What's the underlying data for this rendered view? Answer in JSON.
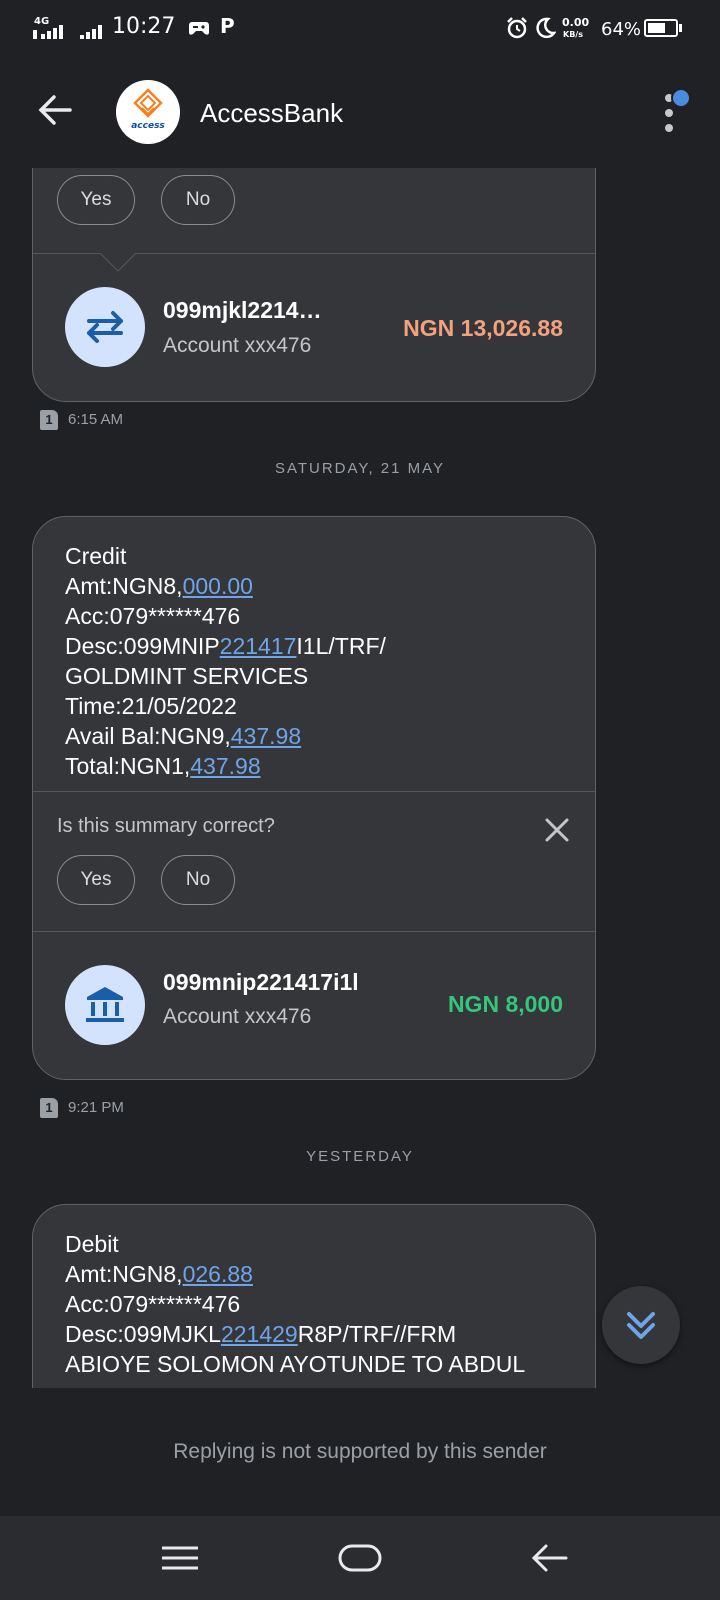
{
  "status_bar": {
    "network": "4G",
    "time": "10:27",
    "speed_value": "0.00",
    "speed_unit": "KB/s",
    "battery": "64%",
    "battery_level": 0.64
  },
  "app_bar": {
    "logo_text": "access",
    "title": "AccessBank"
  },
  "messages": [
    {
      "feedback": {
        "yes": "Yes",
        "no": "No"
      },
      "summary": {
        "title": "099mjkl2214…",
        "account": "Account xxx476",
        "amount": "NGN 13,026.88",
        "amount_color": "#f4a27e"
      },
      "sim": "1",
      "time": "6:15 AM"
    },
    {
      "date_separator": "SATURDAY, 21 MAY",
      "body": {
        "l1": "Credit",
        "l2a": "Amt:NGN8,",
        "l2b": "000.00",
        "l3": "Acc:079******476",
        "l4a": "Desc:099MNIP",
        "l4b": "221417",
        "l4c": "I1L/TRF/",
        "l5": "GOLDMINT SERVICES",
        "l6": "Time:21/05/2022",
        "l7a": "Avail Bal:NGN9,",
        "l7b": "437.98",
        "l8a": "Total:NGN1,",
        "l8b": "437.98"
      },
      "question": "Is this summary correct?",
      "feedback": {
        "yes": "Yes",
        "no": "No"
      },
      "summary": {
        "title": "099mnip221417i1l",
        "account": "Account xxx476",
        "amount": "NGN 8,000",
        "amount_color": "#34c77b"
      },
      "sim": "1",
      "time": "9:21 PM"
    },
    {
      "date_separator": "YESTERDAY",
      "body": {
        "l1": "Debit",
        "l2a": "Amt:NGN8,",
        "l2b": "026.88",
        "l3": "Acc:079******476",
        "l4a": "Desc:099MJKL",
        "l4b": "221429",
        "l4c": "R8P/TRF//FRM",
        "l5": "ABIOYE SOLOMON  AYOTUNDE TO ABDUL"
      }
    }
  ],
  "reply_note": "Replying is not supported by this sender",
  "colors": {
    "accent": "#6fa4e6",
    "credit": "#34c77b",
    "debit": "#f4a27e",
    "background": "#202124",
    "card": "#35363a"
  }
}
